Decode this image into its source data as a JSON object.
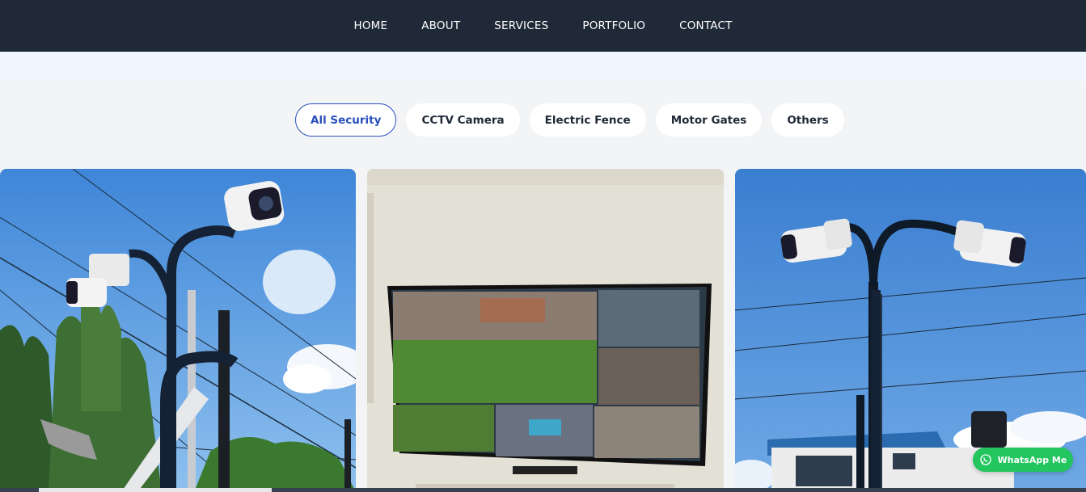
{
  "nav": {
    "items": [
      "HOME",
      "ABOUT",
      "SERVICES",
      "PORTFOLIO",
      "CONTACT"
    ]
  },
  "filters": {
    "items": [
      "All Security",
      "CCTV Camera",
      "Electric Fence",
      "Motor Gates",
      "Others"
    ],
    "active": "All Security"
  },
  "gallery": {
    "items": [
      {
        "subject": "cctv-cameras-on-pole"
      },
      {
        "subject": "cctv-monitor-screen"
      },
      {
        "subject": "cctv-cameras-on-pole-building"
      }
    ]
  },
  "whatsapp": {
    "label": "WhatsApp Me",
    "color": "#22c55e"
  },
  "colors": {
    "navbar": "#1f2937",
    "accent": "#2a4fbf"
  }
}
